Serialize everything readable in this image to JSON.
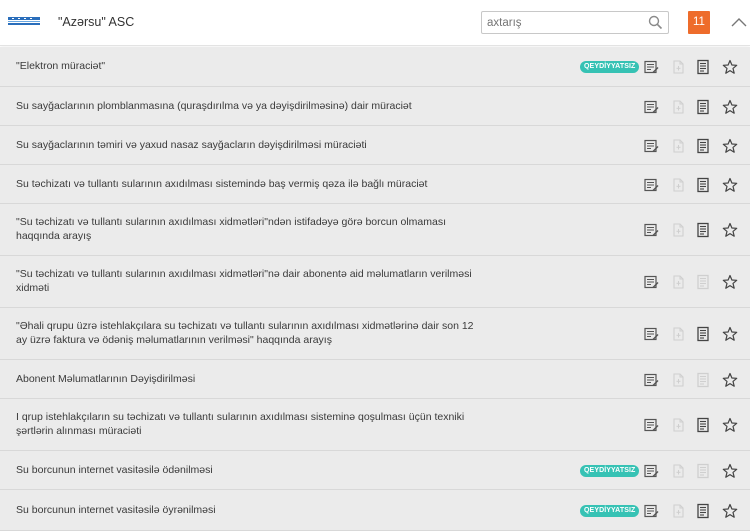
{
  "header": {
    "title": "\"Azərsu\" ASC",
    "search_placeholder": "axtarış",
    "count": "11"
  },
  "items": [
    {
      "text": "\"Elektron müraciət\"",
      "badge": "QEYDİYYATSIZ",
      "doc_active": true
    },
    {
      "text": "Su sayğaclarının plomblanmasına (quraşdırılma və ya dəyişdirilməsinə) dair müraciət",
      "badge": "",
      "doc_active": true
    },
    {
      "text": "Su sayğaclarının təmiri və yaxud nasaz sayğacların dəyişdirilməsi müraciəti",
      "badge": "",
      "doc_active": true
    },
    {
      "text": "Su təchizatı və tullantı sularının axıdılması sistemində baş vermiş qəza ilə bağlı müraciət",
      "badge": "",
      "doc_active": true
    },
    {
      "text": "\"Su təchizatı və tullantı sularının axıdılması xidmətləri\"ndən istifadəyə görə borcun olmaması haqqında arayış",
      "badge": "",
      "doc_active": true
    },
    {
      "text": "\"Su təchizatı və tullantı sularının axıdılması xidmətləri\"nə dair abonentə aid məlumatların verilməsi xidməti",
      "badge": "",
      "doc_active": false
    },
    {
      "text": "\"Əhali qrupu üzrə istehlakçılara su təchizatı və tullantı sularının axıdılması xidmətlərinə dair son 12 ay üzrə faktura və ödəniş məlumatlarının verilməsi\" haqqında arayış",
      "badge": "",
      "doc_active": true
    },
    {
      "text": "Abonent Məlumatlarının Dəyişdirilməsi",
      "badge": "",
      "doc_active": false
    },
    {
      "text": "I qrup istehlakçıların su təchizatı və tullantı sularının axıdılması sisteminə qoşulması üçün texniki şərtlərin alınması müraciəti",
      "badge": "",
      "doc_active": true
    },
    {
      "text": "Su borcunun internet vasitəsilə ödənilməsi",
      "badge": "QEYDİYYATSIZ",
      "doc_active": false
    },
    {
      "text": "Su borcunun internet vasitəsilə öyrənilməsi",
      "badge": "QEYDİYYATSIZ",
      "doc_active": true
    }
  ],
  "icons": {
    "apply": "apply-form-icon",
    "file": "file-icon",
    "document": "document-list-icon",
    "favorite": "star-icon",
    "search": "search-icon",
    "collapse": "chevron-up-icon"
  },
  "colors": {
    "accent_orange": "#ee6c2b",
    "badge_teal": "#36c2b4",
    "row_bg": "#ebebeb"
  }
}
